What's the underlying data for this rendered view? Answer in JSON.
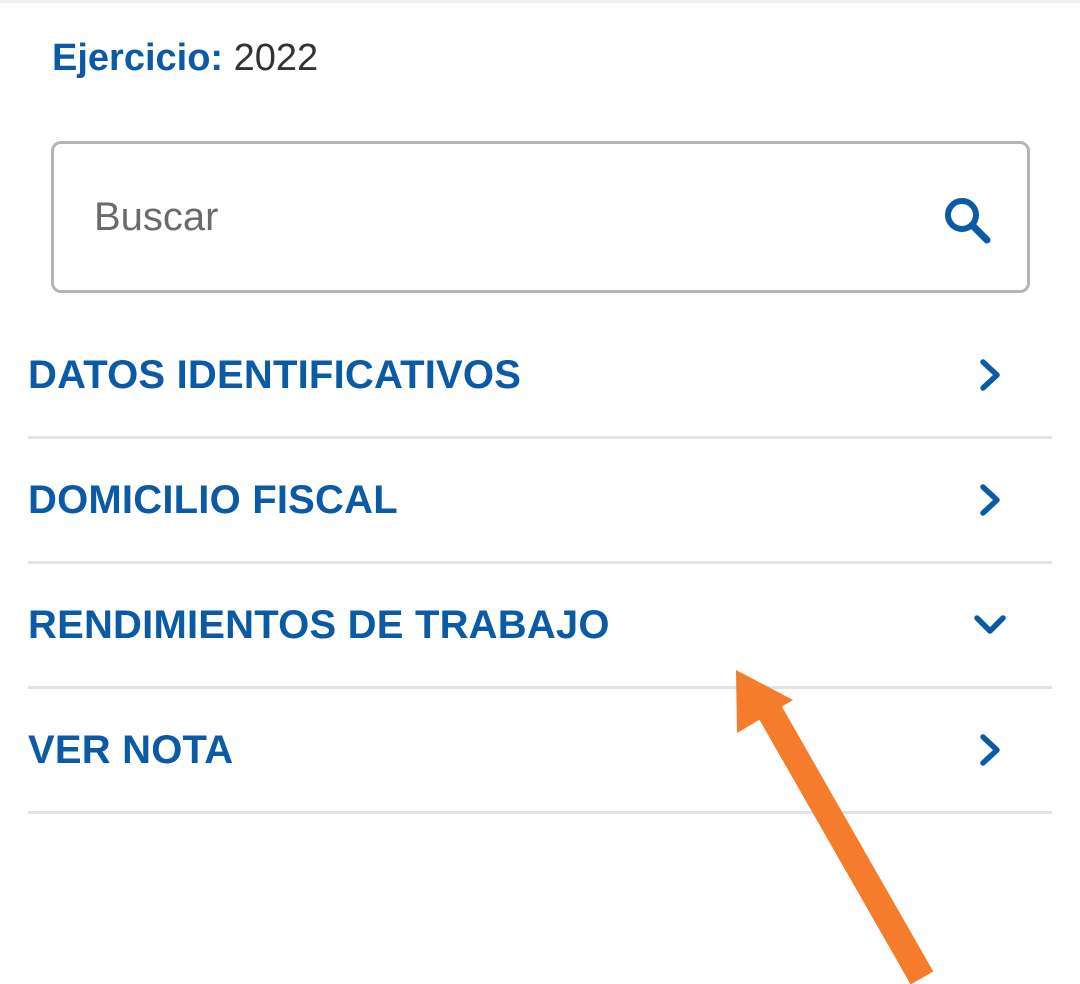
{
  "header": {
    "ejercicio_label": "Ejercicio:",
    "ejercicio_value": "2022"
  },
  "search": {
    "placeholder": "Buscar",
    "icon": "search-icon"
  },
  "menu": {
    "items": [
      {
        "label": "DATOS IDENTIFICATIVOS",
        "icon": "chevron-right-icon",
        "expanded": false
      },
      {
        "label": "DOMICILIO FISCAL",
        "icon": "chevron-right-icon",
        "expanded": false
      },
      {
        "label": "RENDIMIENTOS DE TRABAJO",
        "icon": "chevron-down-icon",
        "expanded": true
      },
      {
        "label": "VER NOTA",
        "icon": "chevron-right-icon",
        "expanded": false
      }
    ]
  },
  "colors": {
    "accent": "#0b5aa5",
    "annotation_arrow": "#f47c2a",
    "divider": "#e3e3e3",
    "input_border": "#b5b5b5"
  },
  "annotation": {
    "icon": "arrow-annotation"
  }
}
